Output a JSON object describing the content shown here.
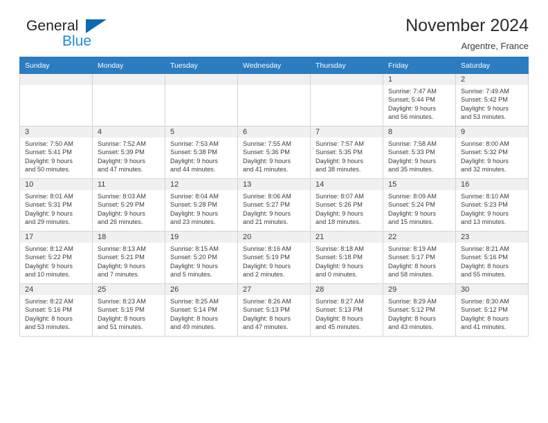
{
  "brand": {
    "word_one": "General",
    "word_two": "Blue",
    "triangle_icon": "triangle-icon",
    "color_dark": "#231f20",
    "color_blue": "#1f8ad6",
    "color_triangle": "#0d6ab0"
  },
  "header": {
    "title": "November 2024",
    "subtitle": "Argentre, France",
    "header_bg": "#2b7cc0"
  },
  "weekday_headers": [
    "Sunday",
    "Monday",
    "Tuesday",
    "Wednesday",
    "Thursday",
    "Friday",
    "Saturday"
  ],
  "labels": {
    "sunrise_prefix": "Sunrise:",
    "sunset_prefix": "Sunset:",
    "daylight_prefix": "Daylight:"
  },
  "weeks": [
    [
      {
        "empty": true
      },
      {
        "empty": true
      },
      {
        "empty": true
      },
      {
        "empty": true
      },
      {
        "empty": true
      },
      {
        "day": "1",
        "sunrise": "Sunrise: 7:47 AM",
        "sunset": "Sunset: 5:44 PM",
        "daylight_line1": "Daylight: 9 hours",
        "daylight_line2": "and 56 minutes."
      },
      {
        "day": "2",
        "sunrise": "Sunrise: 7:49 AM",
        "sunset": "Sunset: 5:42 PM",
        "daylight_line1": "Daylight: 9 hours",
        "daylight_line2": "and 53 minutes."
      }
    ],
    [
      {
        "day": "3",
        "sunrise": "Sunrise: 7:50 AM",
        "sunset": "Sunset: 5:41 PM",
        "daylight_line1": "Daylight: 9 hours",
        "daylight_line2": "and 50 minutes."
      },
      {
        "day": "4",
        "sunrise": "Sunrise: 7:52 AM",
        "sunset": "Sunset: 5:39 PM",
        "daylight_line1": "Daylight: 9 hours",
        "daylight_line2": "and 47 minutes."
      },
      {
        "day": "5",
        "sunrise": "Sunrise: 7:53 AM",
        "sunset": "Sunset: 5:38 PM",
        "daylight_line1": "Daylight: 9 hours",
        "daylight_line2": "and 44 minutes."
      },
      {
        "day": "6",
        "sunrise": "Sunrise: 7:55 AM",
        "sunset": "Sunset: 5:36 PM",
        "daylight_line1": "Daylight: 9 hours",
        "daylight_line2": "and 41 minutes."
      },
      {
        "day": "7",
        "sunrise": "Sunrise: 7:57 AM",
        "sunset": "Sunset: 5:35 PM",
        "daylight_line1": "Daylight: 9 hours",
        "daylight_line2": "and 38 minutes."
      },
      {
        "day": "8",
        "sunrise": "Sunrise: 7:58 AM",
        "sunset": "Sunset: 5:33 PM",
        "daylight_line1": "Daylight: 9 hours",
        "daylight_line2": "and 35 minutes."
      },
      {
        "day": "9",
        "sunrise": "Sunrise: 8:00 AM",
        "sunset": "Sunset: 5:32 PM",
        "daylight_line1": "Daylight: 9 hours",
        "daylight_line2": "and 32 minutes."
      }
    ],
    [
      {
        "day": "10",
        "sunrise": "Sunrise: 8:01 AM",
        "sunset": "Sunset: 5:31 PM",
        "daylight_line1": "Daylight: 9 hours",
        "daylight_line2": "and 29 minutes."
      },
      {
        "day": "11",
        "sunrise": "Sunrise: 8:03 AM",
        "sunset": "Sunset: 5:29 PM",
        "daylight_line1": "Daylight: 9 hours",
        "daylight_line2": "and 26 minutes."
      },
      {
        "day": "12",
        "sunrise": "Sunrise: 8:04 AM",
        "sunset": "Sunset: 5:28 PM",
        "daylight_line1": "Daylight: 9 hours",
        "daylight_line2": "and 23 minutes."
      },
      {
        "day": "13",
        "sunrise": "Sunrise: 8:06 AM",
        "sunset": "Sunset: 5:27 PM",
        "daylight_line1": "Daylight: 9 hours",
        "daylight_line2": "and 21 minutes."
      },
      {
        "day": "14",
        "sunrise": "Sunrise: 8:07 AM",
        "sunset": "Sunset: 5:26 PM",
        "daylight_line1": "Daylight: 9 hours",
        "daylight_line2": "and 18 minutes."
      },
      {
        "day": "15",
        "sunrise": "Sunrise: 8:09 AM",
        "sunset": "Sunset: 5:24 PM",
        "daylight_line1": "Daylight: 9 hours",
        "daylight_line2": "and 15 minutes."
      },
      {
        "day": "16",
        "sunrise": "Sunrise: 8:10 AM",
        "sunset": "Sunset: 5:23 PM",
        "daylight_line1": "Daylight: 9 hours",
        "daylight_line2": "and 13 minutes."
      }
    ],
    [
      {
        "day": "17",
        "sunrise": "Sunrise: 8:12 AM",
        "sunset": "Sunset: 5:22 PM",
        "daylight_line1": "Daylight: 9 hours",
        "daylight_line2": "and 10 minutes."
      },
      {
        "day": "18",
        "sunrise": "Sunrise: 8:13 AM",
        "sunset": "Sunset: 5:21 PM",
        "daylight_line1": "Daylight: 9 hours",
        "daylight_line2": "and 7 minutes."
      },
      {
        "day": "19",
        "sunrise": "Sunrise: 8:15 AM",
        "sunset": "Sunset: 5:20 PM",
        "daylight_line1": "Daylight: 9 hours",
        "daylight_line2": "and 5 minutes."
      },
      {
        "day": "20",
        "sunrise": "Sunrise: 8:16 AM",
        "sunset": "Sunset: 5:19 PM",
        "daylight_line1": "Daylight: 9 hours",
        "daylight_line2": "and 2 minutes."
      },
      {
        "day": "21",
        "sunrise": "Sunrise: 8:18 AM",
        "sunset": "Sunset: 5:18 PM",
        "daylight_line1": "Daylight: 9 hours",
        "daylight_line2": "and 0 minutes."
      },
      {
        "day": "22",
        "sunrise": "Sunrise: 8:19 AM",
        "sunset": "Sunset: 5:17 PM",
        "daylight_line1": "Daylight: 8 hours",
        "daylight_line2": "and 58 minutes."
      },
      {
        "day": "23",
        "sunrise": "Sunrise: 8:21 AM",
        "sunset": "Sunset: 5:16 PM",
        "daylight_line1": "Daylight: 8 hours",
        "daylight_line2": "and 55 minutes."
      }
    ],
    [
      {
        "day": "24",
        "sunrise": "Sunrise: 8:22 AM",
        "sunset": "Sunset: 5:16 PM",
        "daylight_line1": "Daylight: 8 hours",
        "daylight_line2": "and 53 minutes."
      },
      {
        "day": "25",
        "sunrise": "Sunrise: 8:23 AM",
        "sunset": "Sunset: 5:15 PM",
        "daylight_line1": "Daylight: 8 hours",
        "daylight_line2": "and 51 minutes."
      },
      {
        "day": "26",
        "sunrise": "Sunrise: 8:25 AM",
        "sunset": "Sunset: 5:14 PM",
        "daylight_line1": "Daylight: 8 hours",
        "daylight_line2": "and 49 minutes."
      },
      {
        "day": "27",
        "sunrise": "Sunrise: 8:26 AM",
        "sunset": "Sunset: 5:13 PM",
        "daylight_line1": "Daylight: 8 hours",
        "daylight_line2": "and 47 minutes."
      },
      {
        "day": "28",
        "sunrise": "Sunrise: 8:27 AM",
        "sunset": "Sunset: 5:13 PM",
        "daylight_line1": "Daylight: 8 hours",
        "daylight_line2": "and 45 minutes."
      },
      {
        "day": "29",
        "sunrise": "Sunrise: 8:29 AM",
        "sunset": "Sunset: 5:12 PM",
        "daylight_line1": "Daylight: 8 hours",
        "daylight_line2": "and 43 minutes."
      },
      {
        "day": "30",
        "sunrise": "Sunrise: 8:30 AM",
        "sunset": "Sunset: 5:12 PM",
        "daylight_line1": "Daylight: 8 hours",
        "daylight_line2": "and 41 minutes."
      }
    ]
  ]
}
